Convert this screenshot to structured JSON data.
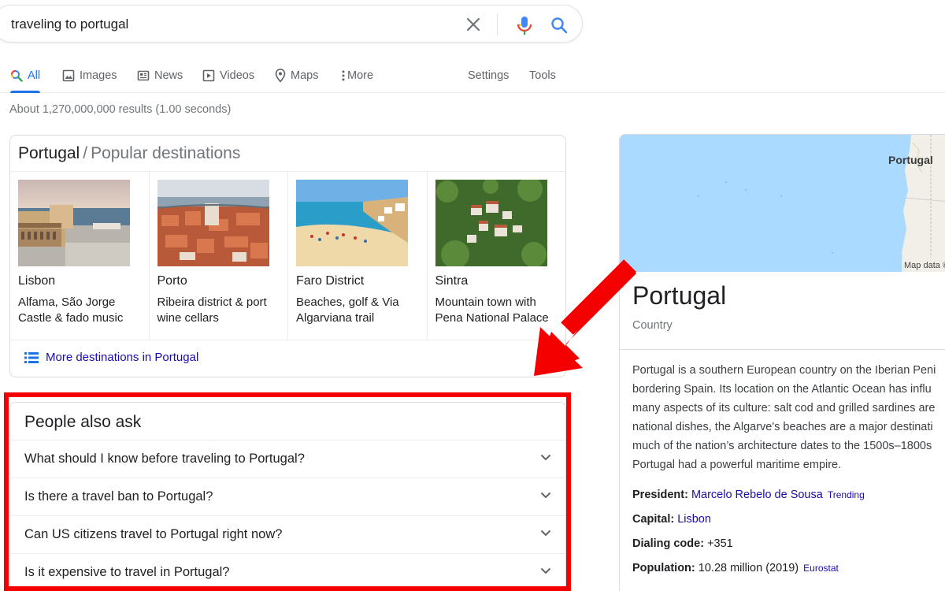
{
  "search": {
    "query": "traveling to portugal"
  },
  "tabs": [
    {
      "label": "All",
      "icon": "search-multicolor-icon"
    },
    {
      "label": "Images",
      "icon": "image-icon"
    },
    {
      "label": "News",
      "icon": "newspaper-icon"
    },
    {
      "label": "Videos",
      "icon": "play-icon"
    },
    {
      "label": "Maps",
      "icon": "map-pin-icon"
    },
    {
      "label": "More",
      "icon": "dots-vertical-icon"
    },
    {
      "label": "Settings"
    },
    {
      "label": "Tools"
    }
  ],
  "result_stats": "About 1,270,000,000 results (1.00 seconds)",
  "destinations": {
    "title": "Portugal",
    "separator": "/",
    "subtitle": "Popular destinations",
    "items": [
      {
        "name": "Lisbon",
        "desc1": "Alfama, São Jorge",
        "desc2": "Castle & fado music"
      },
      {
        "name": "Porto",
        "desc1": "Ribeira district & port",
        "desc2": "wine cellars"
      },
      {
        "name": "Faro District",
        "desc1": "Beaches, golf & Via",
        "desc2": "Algarviana trail"
      },
      {
        "name": "Sintra",
        "desc1": "Mountain town with",
        "desc2": "Pena National Palace"
      }
    ],
    "more_link": "More destinations in Portugal"
  },
  "people_also_ask": {
    "title": "People also ask",
    "questions": [
      "What should I know before traveling to Portugal?",
      "Is there a travel ban to Portugal?",
      "Can US citizens travel to Portugal right now?",
      "Is it expensive to travel in Portugal?"
    ]
  },
  "knowledge_panel": {
    "map_label": "Portugal",
    "map_attribution": "Map data ©",
    "title": "Portugal",
    "subtitle": "Country",
    "description_lines": [
      "Portugal is a southern European country on the Iberian Peni",
      "bordering Spain. Its location on the Atlantic Ocean has influ",
      "many aspects of its culture: salt cod and grilled sardines are",
      "national dishes, the Algarve's beaches are a major destinati",
      "much of the nation’s architecture dates to the 1500s–1800s",
      "Portugal had a powerful maritime empire."
    ],
    "facts": {
      "president_label": "President:",
      "president_value": "Marcelo Rebelo de Sousa",
      "president_tag": "Trending",
      "capital_label": "Capital:",
      "capital_value": "Lisbon",
      "dialing_label": "Dialing code:",
      "dialing_value": "+351",
      "population_label": "Population:",
      "population_value": "10.28 million (2019)",
      "population_source": "Eurostat"
    }
  },
  "colors": {
    "accent_blue": "#1a73e8",
    "link": "#1a0dab",
    "highlight_red": "#f50000",
    "map_water": "#aadaff"
  }
}
